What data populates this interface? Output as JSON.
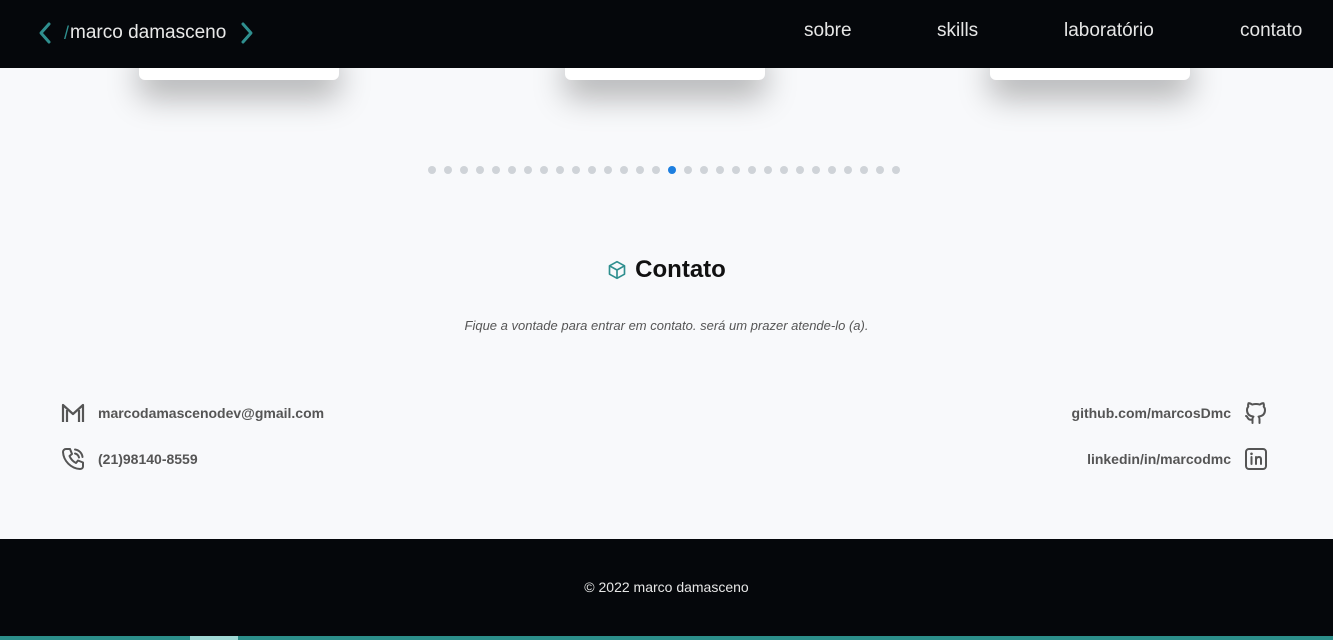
{
  "header": {
    "logo_slash": "/",
    "logo_text": "marco damasceno",
    "nav": {
      "sobre": "sobre",
      "skills": "skills",
      "laboratorio": "laboratório",
      "contato": "contato"
    }
  },
  "carousel": {
    "dot_count": 30,
    "active_index": 15,
    "colors": {
      "dot": "#cfd3d8",
      "active": "#1d7fe0"
    }
  },
  "contact": {
    "title": "Contato",
    "subtitle": "Fique a vontade para entrar em contato. será um prazer atende-lo (a).",
    "email": "marcodamascenodev@gmail.com",
    "phone": "(21)98140-8559",
    "github": "github.com/marcosDmc",
    "linkedin": "linkedin/in/marcodmc",
    "icons": {
      "email": "gmail-icon",
      "phone": "phone-call-icon",
      "github": "github-icon",
      "linkedin": "linkedin-icon",
      "title": "cube-icon"
    }
  },
  "footer": {
    "copyright": "© 2022 marco damasceno"
  },
  "colors": {
    "accent": "#2f8f8f",
    "background": "#f8f9fb",
    "dark": "#05070b"
  }
}
